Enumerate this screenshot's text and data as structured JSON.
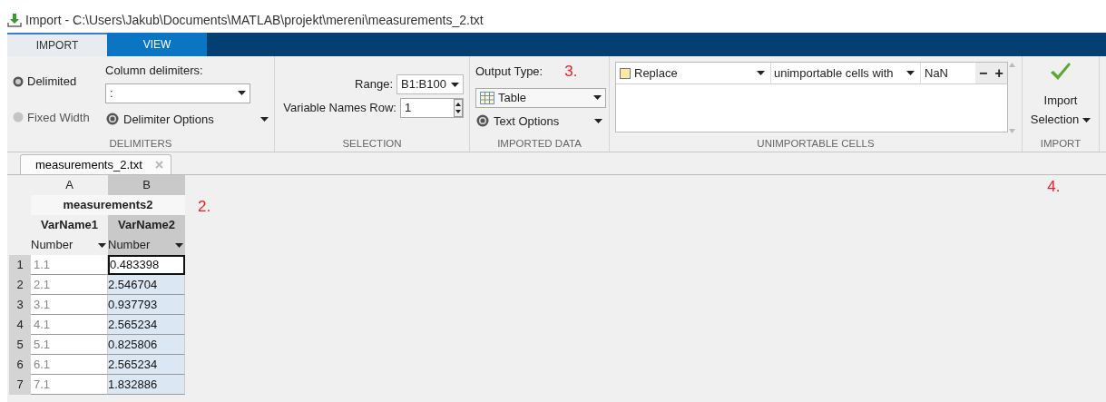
{
  "window": {
    "title": "Import - C:\\Users\\Jakub\\Documents\\MATLAB\\projekt\\mereni\\measurements_2.txt"
  },
  "tabs": [
    {
      "label": "IMPORT",
      "selected": true
    },
    {
      "label": "VIEW",
      "selected": false
    }
  ],
  "ribbon": {
    "delimiters": {
      "radios": [
        {
          "label": "Delimited",
          "selected": true
        },
        {
          "label": "Fixed Width",
          "selected": false
        }
      ],
      "column_delimiters_label": "Column delimiters:",
      "column_delimiters_value": ":",
      "options_button": "Delimiter Options",
      "section_label": "DELIMITERS"
    },
    "selection": {
      "range_label": "Range:",
      "range_value": "B1:B100",
      "names_row_label": "Variable Names Row:",
      "names_row_value": "1",
      "section_label": "SELECTION"
    },
    "imported_data": {
      "output_type_label": "Output Type:",
      "output_type_value": "Table",
      "options_button": "Text Options",
      "section_label": "IMPORTED DATA"
    },
    "unimportable_cells": {
      "rule": {
        "checked": false,
        "action": "Replace",
        "condition": "unimportable cells with",
        "value": "NaN"
      },
      "remove_button": "−",
      "add_button": "+",
      "section_label": "UNIMPORTABLE CELLS"
    },
    "import": {
      "button_line_1": "Import",
      "button_line_2": "Selection",
      "section_label": "IMPORT"
    }
  },
  "document_tabs": [
    {
      "label": "measurements_2.txt",
      "selected": true
    }
  ],
  "grid": {
    "table_name": "measurements2",
    "columns": [
      {
        "letter": "A",
        "name": "VarName1",
        "type": "Number",
        "selected": false
      },
      {
        "letter": "B",
        "name": "VarName2",
        "type": "Number",
        "selected": true
      }
    ],
    "rows": [
      {
        "number": "1",
        "cells": [
          {
            "text": "1.1",
            "selected": false,
            "active": false
          },
          {
            "text": "0.483398",
            "selected": true,
            "active": true
          }
        ]
      },
      {
        "number": "2",
        "cells": [
          {
            "text": "2.1",
            "selected": false,
            "active": false
          },
          {
            "text": "2.546704",
            "selected": true,
            "active": false
          }
        ]
      },
      {
        "number": "3",
        "cells": [
          {
            "text": "3.1",
            "selected": false,
            "active": false
          },
          {
            "text": "0.937793",
            "selected": true,
            "active": false
          }
        ]
      },
      {
        "number": "4",
        "cells": [
          {
            "text": "4.1",
            "selected": false,
            "active": false
          },
          {
            "text": "2.565234",
            "selected": true,
            "active": false
          }
        ]
      },
      {
        "number": "5",
        "cells": [
          {
            "text": "5.1",
            "selected": false,
            "active": false
          },
          {
            "text": "0.825806",
            "selected": true,
            "active": false
          }
        ]
      },
      {
        "number": "6",
        "cells": [
          {
            "text": "6.1",
            "selected": false,
            "active": false
          },
          {
            "text": "2.565234",
            "selected": true,
            "active": false
          }
        ]
      },
      {
        "number": "7",
        "cells": [
          {
            "text": "7.1",
            "selected": false,
            "active": false
          },
          {
            "text": "1.832886",
            "selected": true,
            "active": false
          }
        ]
      }
    ]
  },
  "annotations": [
    "2.",
    "3.",
    "4."
  ]
}
